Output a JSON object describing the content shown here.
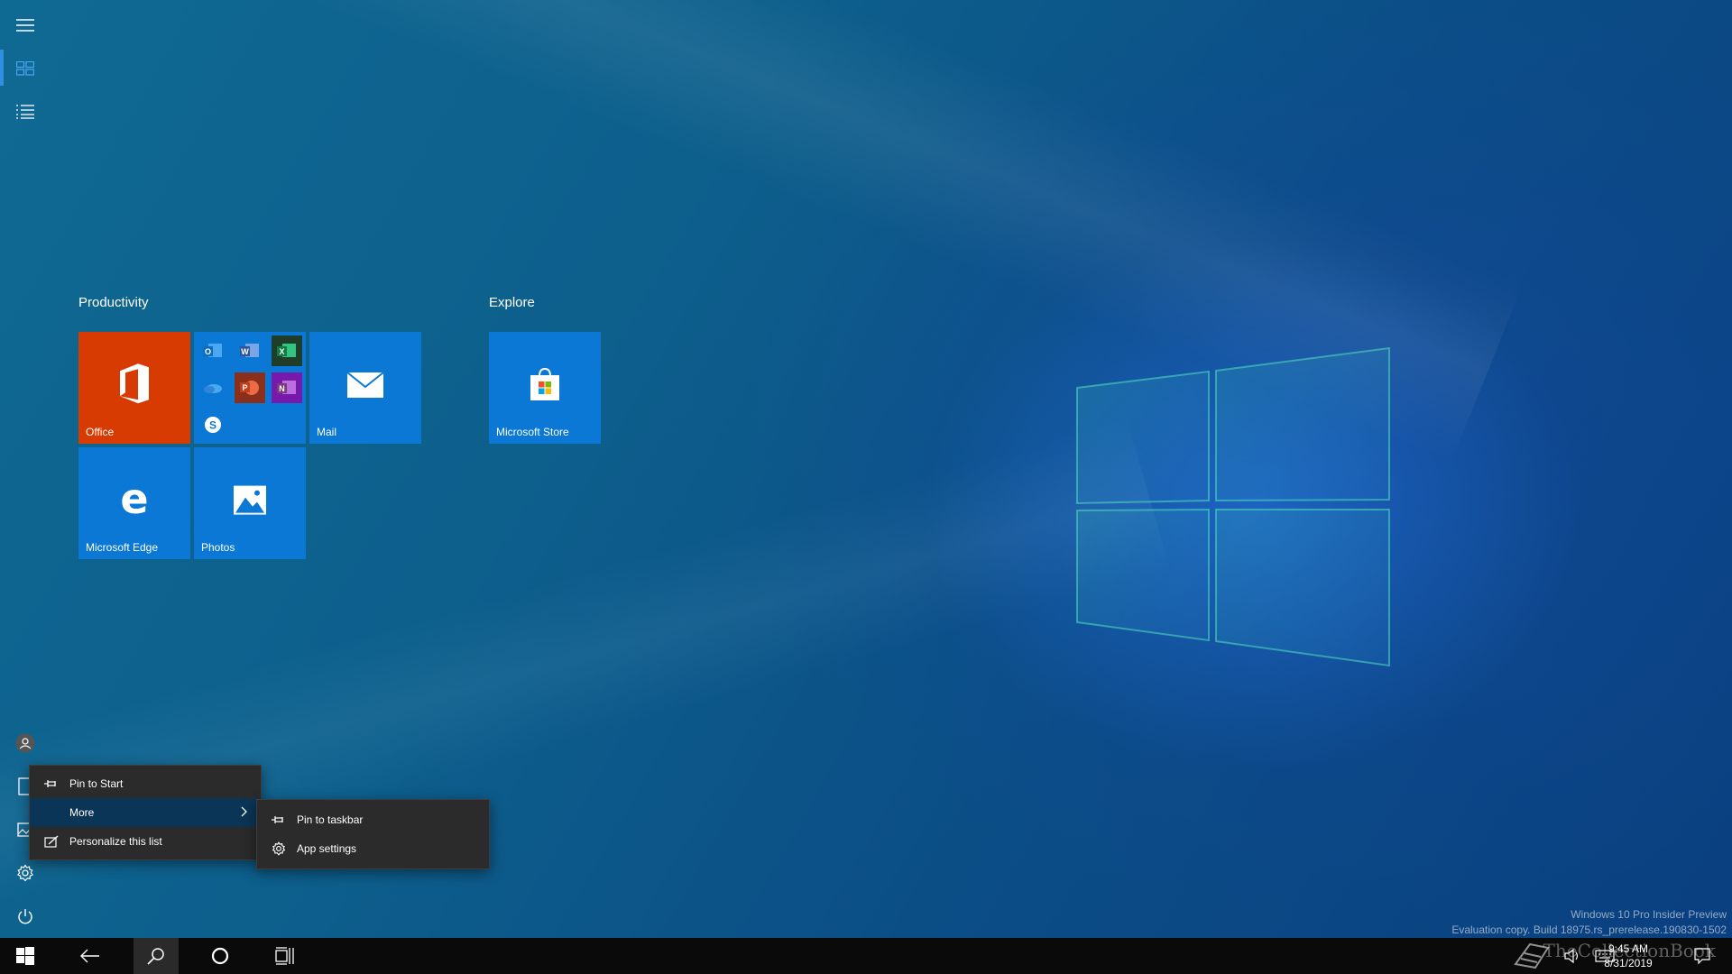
{
  "start": {
    "groups": [
      {
        "title": "Productivity"
      },
      {
        "title": "Explore"
      }
    ],
    "tiles": {
      "office": "Office",
      "mail": "Mail",
      "edge": "Microsoft Edge",
      "photos": "Photos",
      "store": "Microsoft Store"
    },
    "office_folder_apps": [
      "Outlook",
      "Word",
      "Excel",
      "OneDrive",
      "PowerPoint",
      "OneNote",
      "Skype"
    ]
  },
  "context_menu": {
    "items": [
      "Pin to Start",
      "More",
      "Personalize this list"
    ],
    "highlighted": "More"
  },
  "submenu": {
    "items": [
      "Pin to taskbar",
      "App settings"
    ]
  },
  "taskbar": {
    "time": "9:45 AM",
    "date": "8/31/2019"
  },
  "watermark": {
    "line1": "Windows 10 Pro Insider Preview",
    "line2": "Evaluation copy. Build 18975.rs_prerelease.190830-1502"
  },
  "branding": "TheCollectionBook",
  "colors": {
    "accent": "#0a78d4",
    "office_tile": "#d83b01",
    "menu_bg": "#2b2b2b",
    "menu_highlight": "#0b3556",
    "taskbar": "#0a0a0a"
  }
}
